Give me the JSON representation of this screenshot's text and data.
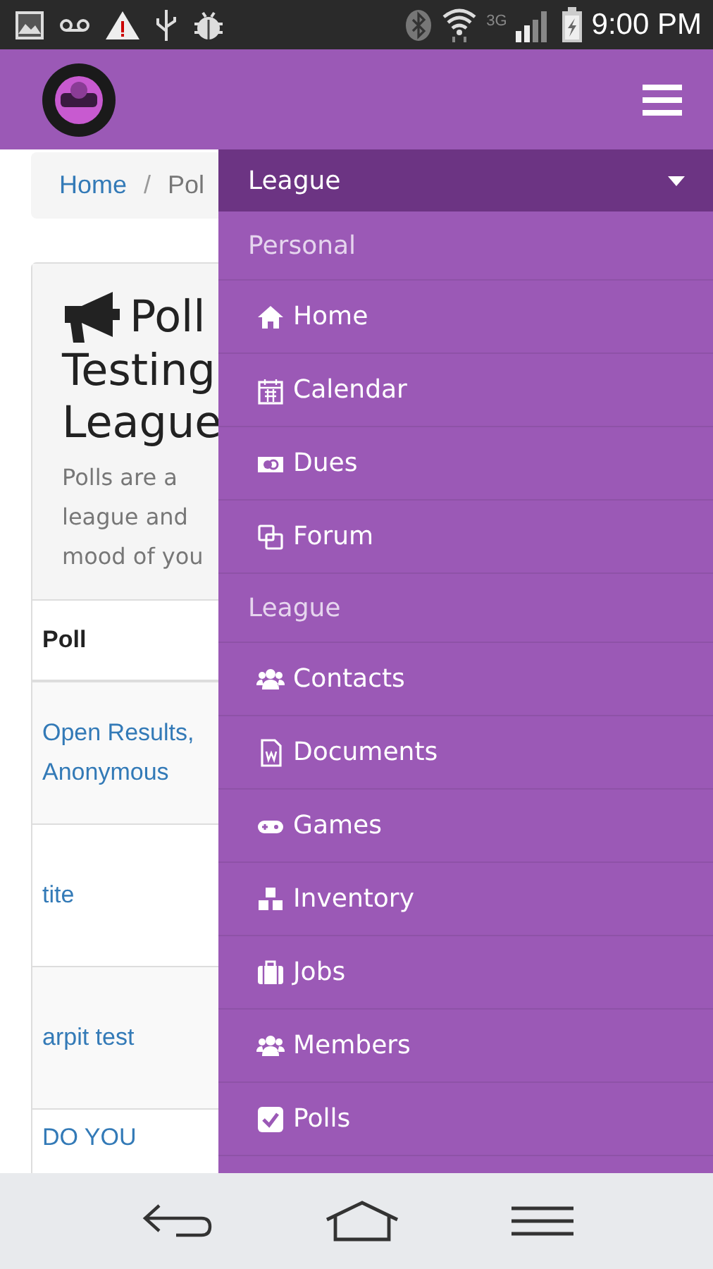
{
  "status_bar": {
    "network": "3G",
    "time": "9:00 PM"
  },
  "breadcrumb": {
    "items": [
      {
        "label": "Home",
        "selected": false
      },
      {
        "label": "Pol",
        "selected": true
      }
    ],
    "separator": "/"
  },
  "card": {
    "title_lines": [
      "Poll",
      "Testing",
      "League"
    ],
    "description_lines": [
      "Polls are a",
      "league and",
      "mood of you"
    ]
  },
  "table": {
    "columns": [
      "Poll"
    ],
    "rows": [
      {
        "poll": "Open Results, Anonymous"
      },
      {
        "poll": "tite"
      },
      {
        "poll": "arpit test"
      },
      {
        "poll": "DO YOU"
      }
    ]
  },
  "drawer": {
    "header": "League",
    "expanded": true,
    "items": [
      {
        "kind": "section",
        "label": "Personal"
      },
      {
        "kind": "link",
        "label": "Home"
      },
      {
        "kind": "link",
        "label": "Calendar"
      },
      {
        "kind": "link",
        "label": "Dues"
      },
      {
        "kind": "link",
        "label": "Forum"
      },
      {
        "kind": "section",
        "label": "League"
      },
      {
        "kind": "link",
        "label": "Contacts"
      },
      {
        "kind": "link",
        "label": "Documents"
      },
      {
        "kind": "link",
        "label": "Games"
      },
      {
        "kind": "link",
        "label": "Inventory"
      },
      {
        "kind": "link",
        "label": "Jobs"
      },
      {
        "kind": "link",
        "label": "Members"
      },
      {
        "kind": "link",
        "label": "Polls"
      }
    ]
  }
}
